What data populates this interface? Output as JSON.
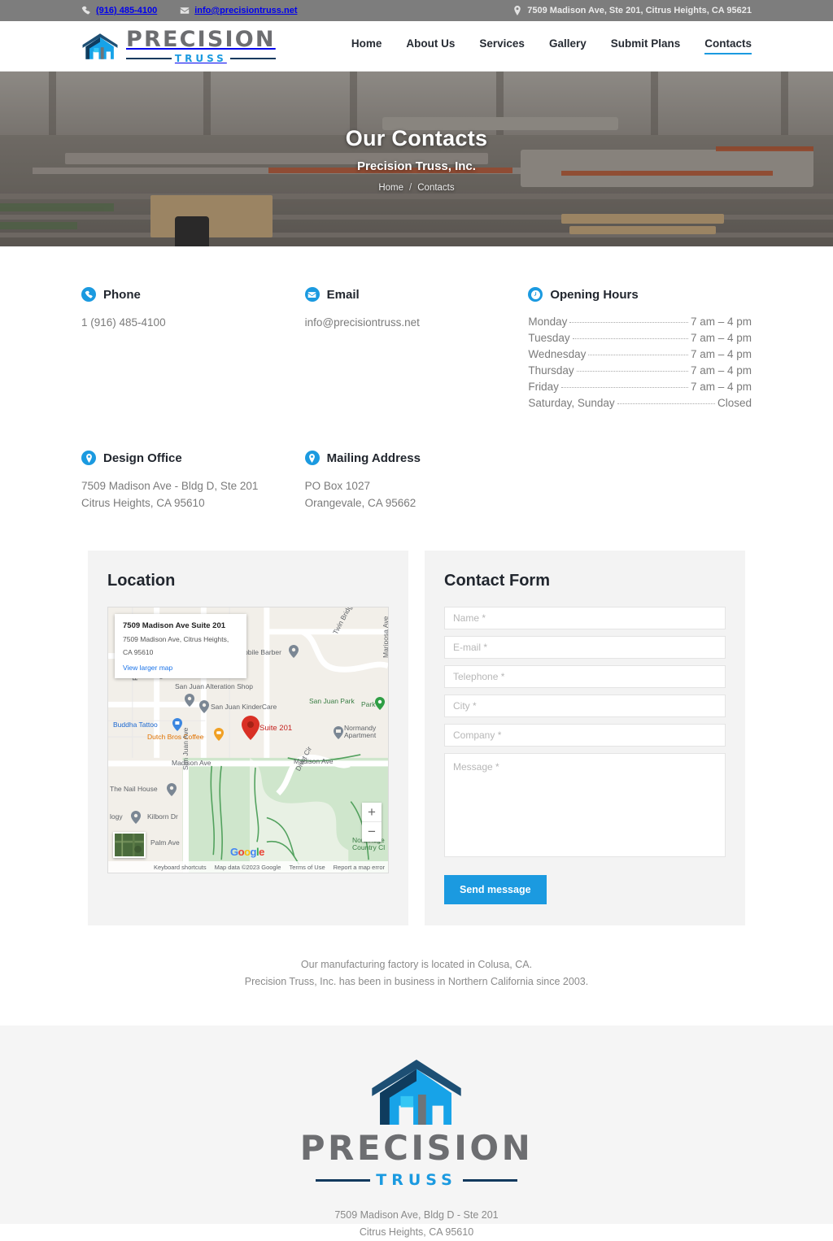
{
  "topbar": {
    "phone": "(916) 485-4100",
    "email": "info@precisiontruss.net",
    "address": "7509 Madison Ave, Ste 201, Citrus Heights, CA 95621",
    "phone_icon": "phone-icon",
    "email_icon": "envelope-icon",
    "location_icon": "map-pin-icon"
  },
  "brand": {
    "name_main": "PRECISION",
    "name_sub": "TRUSS",
    "logo_icon": "precision-truss-house-logo"
  },
  "nav": {
    "items": [
      {
        "label": "Home",
        "active": false
      },
      {
        "label": "About Us",
        "active": false
      },
      {
        "label": "Services",
        "active": false
      },
      {
        "label": "Gallery",
        "active": false
      },
      {
        "label": "Submit Plans",
        "active": false
      },
      {
        "label": "Contacts",
        "active": true
      }
    ]
  },
  "hero": {
    "title": "Our Contacts",
    "subtitle": "Precision Truss, Inc.",
    "breadcrumb_home": "Home",
    "breadcrumb_sep": "/",
    "breadcrumb_current": "Contacts",
    "background": "truss-factory-photo"
  },
  "contact_info": {
    "phone": {
      "title": "Phone",
      "icon": "phone-icon",
      "value": "1 (916) 485-4100"
    },
    "email": {
      "title": "Email",
      "icon": "envelope-icon",
      "value": "info@precisiontruss.net"
    },
    "hours": {
      "title": "Opening Hours",
      "icon": "clock-icon",
      "rows": [
        {
          "day": "Monday",
          "value": "7 am – 4 pm"
        },
        {
          "day": "Tuesday",
          "value": "7 am – 4 pm"
        },
        {
          "day": "Wednesday",
          "value": "7 am – 4 pm"
        },
        {
          "day": "Thursday",
          "value": "7 am – 4 pm"
        },
        {
          "day": "Friday",
          "value": "7 am – 4 pm"
        },
        {
          "day": "Saturday, Sunday",
          "value": "Closed"
        }
      ]
    },
    "design_office": {
      "title": "Design Office",
      "icon": "map-pin-icon",
      "line1": "7509 Madison Ave - Bldg D, Ste 201",
      "line2": "Citrus Heights, CA 95610"
    },
    "mailing_address": {
      "title": "Mailing Address",
      "icon": "map-pin-icon",
      "line1": "PO Box 1027",
      "line2": "Orangevale, CA 95662"
    }
  },
  "location_panel": {
    "title": "Location",
    "map": {
      "card_title": "7509 Madison Ave Suite 201",
      "card_address_line1": "7509 Madison Ave, Citrus Heights,",
      "card_address_line2": "CA 95610",
      "card_link": "View larger map",
      "marker_label": "Suite 201",
      "zoom_in": "+",
      "zoom_out": "−",
      "attribution_google": "Google",
      "labels": [
        "Mobile Barber",
        "Twin Bridges Ln",
        "Mariposa Ave",
        "San Juan Alteration Shop",
        "San Juan KinderCare",
        "San Juan Park",
        "Park",
        "Buddha Tattoo",
        "Dutch Bros Coffee",
        "Normandy Apartment",
        "Fleetwood Dr",
        "Gladstone Way",
        "Madison Ave",
        "Divot Cir",
        "The Nail House",
        "Kilborn Dr",
        "San Juan Ave",
        "Palm Ave",
        "logy",
        "Northridge Country Cl"
      ],
      "footer": {
        "keyboard": "Keyboard shortcuts",
        "mapdata": "Map data ©2023 Google",
        "terms": "Terms of Use",
        "report": "Report a map error"
      }
    }
  },
  "contact_form": {
    "title": "Contact Form",
    "fields": [
      {
        "name": "name",
        "placeholder": "Name *",
        "value": ""
      },
      {
        "name": "email",
        "placeholder": "E-mail *",
        "value": ""
      },
      {
        "name": "telephone",
        "placeholder": "Telephone *",
        "value": ""
      },
      {
        "name": "city",
        "placeholder": "City *",
        "value": ""
      },
      {
        "name": "company",
        "placeholder": "Company *",
        "value": ""
      }
    ],
    "message": {
      "placeholder": "Message *",
      "value": ""
    },
    "submit_label": "Send message"
  },
  "note": {
    "line1": "Our manufacturing factory is located in Colusa, CA.",
    "line2": "Precision Truss, Inc. has been in business in Northern California since 2003."
  },
  "footer": {
    "address_line1": "7509 Madison Ave, Bldg D - Ste 201",
    "address_line2": "Citrus Heights, CA 95610"
  },
  "colors": {
    "accent": "#1b9ae0",
    "dark_navy": "#12395e",
    "logo_gray": "#6d6e71",
    "topbar_bg": "#7d7d7d",
    "panel_bg": "#f3f3f3",
    "footer_bg": "#f5f5f5",
    "text_gray": "#7b7b7b",
    "heading_dark": "#21262e"
  }
}
